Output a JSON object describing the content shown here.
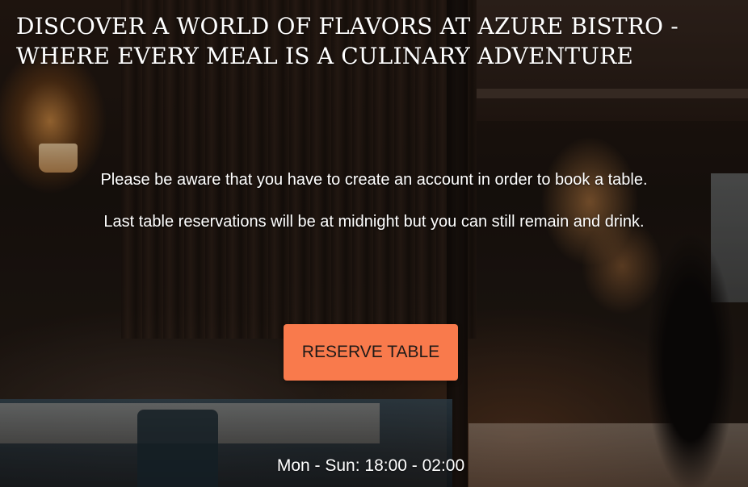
{
  "hero": {
    "headline": "DISCOVER A WORLD OF FLAVORS AT AZURE BISTRO - WHERE EVERY MEAL IS A CULINARY ADVENTURE",
    "notices": [
      "Please be aware that you have to create an account in order to book a table.",
      "Last table reservations will be at midnight but you can still remain and drink."
    ],
    "reserve_label": "RESERVE TABLE",
    "hours": "Mon - Sun: 18:00 - 02:00"
  },
  "colors": {
    "button_background": "#f97a4c",
    "button_text": "#1f1a18",
    "text": "#ffffff"
  }
}
